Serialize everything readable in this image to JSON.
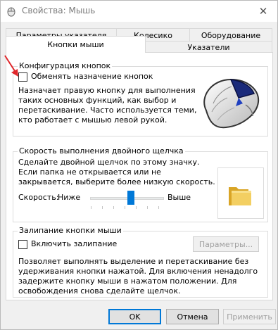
{
  "window": {
    "title": "Свойства: Мышь",
    "close_glyph": "✕"
  },
  "tabs": [
    {
      "label": "Параметры указателя",
      "active": false
    },
    {
      "label": "Колесико",
      "active": false
    },
    {
      "label": "Оборудование",
      "active": false
    },
    {
      "label": "Кнопки мыши",
      "active": true
    },
    {
      "label": "Указатели",
      "active": false
    }
  ],
  "button_config": {
    "title": "Конфигурация кнопок",
    "swap_label": "Обменять назначение кнопок",
    "swap_checked": false,
    "description_lines": [
      "Назначает правую кнопку для выполнения",
      "таких основных функций, как выбор и",
      "перетаскивание. Часто используется теми,",
      "кто работает с мышью левой рукой."
    ]
  },
  "double_click": {
    "title": "Скорость выполнения двойного щелчка",
    "description_lines": [
      "Сделайте двойной щелчок по этому значку.",
      "Если папка не открывается или не",
      "закрывается, выберите более низкую скорость."
    ],
    "speed_label": "Скорость:",
    "low_label": "Ниже",
    "high_label": "Выше",
    "speed_value": 0.55
  },
  "click_lock": {
    "title": "Залипание кнопки мыши",
    "enable_label": "Включить залипание",
    "enable_checked": false,
    "settings_button": "Параметры...",
    "description_lines": [
      "Позволяет выполнять выделение и перетаскивание без",
      "удерживания кнопки нажатой. Для включения ненадолго",
      "задержите кнопку мыши в нажатом положении. Для",
      "освобождения снова сделайте щелчок."
    ]
  },
  "footer": {
    "ok": "OK",
    "cancel": "Отмена",
    "apply": "Применить"
  },
  "colors": {
    "accent": "#0078d7",
    "annotation_arrow": "#e0262a"
  },
  "icons": [
    "mouse-app-icon",
    "close-icon",
    "mouse-illustration",
    "folder-icon",
    "red-arrow-annotation"
  ]
}
